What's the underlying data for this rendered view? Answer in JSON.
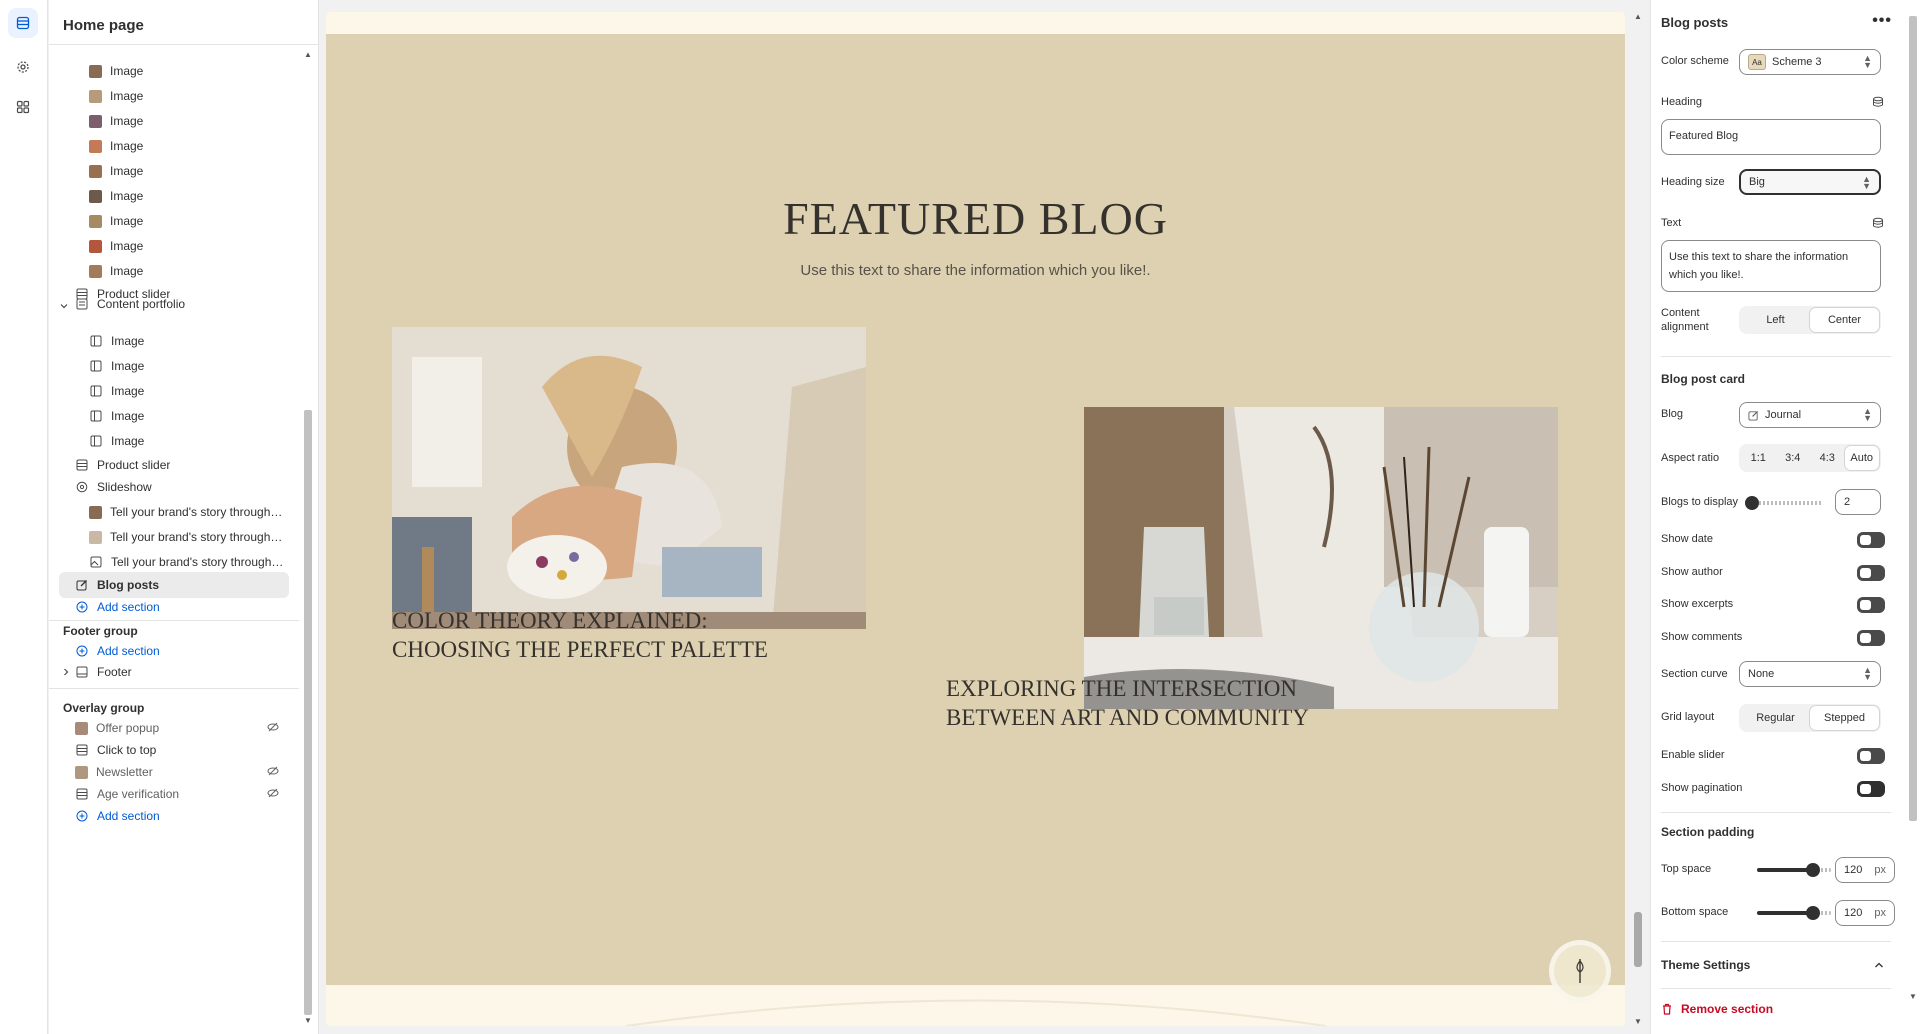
{
  "rail": {
    "icons": [
      "sections-icon",
      "settings-icon",
      "apps-icon"
    ]
  },
  "sidebar": {
    "title": "Home page",
    "image_items": [
      "Image",
      "Image",
      "Image",
      "Image",
      "Image",
      "Image",
      "Image",
      "Image",
      "Image"
    ],
    "product_slider_1": "Product slider",
    "content_portfolio": "Content portfolio",
    "portfolio_items": [
      "Image",
      "Image",
      "Image",
      "Image",
      "Image"
    ],
    "product_slider_2": "Product slider",
    "slideshow": "Slideshow",
    "slides": [
      "Tell your brand's story through images",
      "Tell your brand's story through images",
      "Tell your brand's story through images"
    ],
    "blog_posts": "Blog posts",
    "add_section": "Add section",
    "footer_group": "Footer group",
    "footer": "Footer",
    "overlay_group": "Overlay group",
    "overlay_items": [
      "Offer popup",
      "Click to top",
      "Newsletter",
      "Age verification"
    ]
  },
  "preview": {
    "heading": "FEATURED BLOG",
    "subheading": "Use this text to share the information which you like!.",
    "cards": [
      {
        "title": "COLOR THEORY EXPLAINED: CHOOSING THE PERFECT PALETTE"
      },
      {
        "title": "EXPLORING THE INTERSECTION BETWEEN ART AND COMMUNITY"
      }
    ]
  },
  "panel": {
    "title": "Blog posts",
    "more": "•••",
    "color_scheme_label": "Color scheme",
    "color_scheme_value": "Scheme 3",
    "color_scheme_swatch": "Aa",
    "heading_label": "Heading",
    "heading_value": "Featured Blog",
    "heading_size_label": "Heading size",
    "heading_size_value": "Big",
    "text_label": "Text",
    "text_value": "Use this text to share the information which you like!.",
    "content_alignment_label": "Content alignment",
    "alignment_options": [
      "Left",
      "Center"
    ],
    "alignment_selected": "Center",
    "blog_post_card": "Blog post card",
    "blog_label": "Blog",
    "blog_value": "Journal",
    "aspect_ratio_label": "Aspect ratio",
    "aspect_options": [
      "1:1",
      "3:4",
      "4:3",
      "Auto"
    ],
    "aspect_selected": "Auto",
    "blogs_to_display_label": "Blogs to display",
    "blogs_to_display_value": "2",
    "toggles": [
      {
        "label": "Show date",
        "on": false
      },
      {
        "label": "Show author",
        "on": false
      },
      {
        "label": "Show excerpts",
        "on": false
      },
      {
        "label": "Show comments",
        "on": false
      }
    ],
    "section_curve_label": "Section curve",
    "section_curve_value": "None",
    "grid_layout_label": "Grid layout",
    "grid_options": [
      "Regular",
      "Stepped"
    ],
    "grid_selected": "Stepped",
    "enable_slider_label": "Enable slider",
    "show_pagination_label": "Show pagination",
    "section_padding": "Section padding",
    "top_space_label": "Top space",
    "top_space_value": "120",
    "bottom_space_label": "Bottom space",
    "bottom_space_value": "120",
    "unit": "px",
    "theme_settings": "Theme Settings",
    "remove_section": "Remove section"
  },
  "colors": {
    "accent": "#005bd3",
    "section_bg": "#ded1b1",
    "danger": "#c70a24"
  }
}
